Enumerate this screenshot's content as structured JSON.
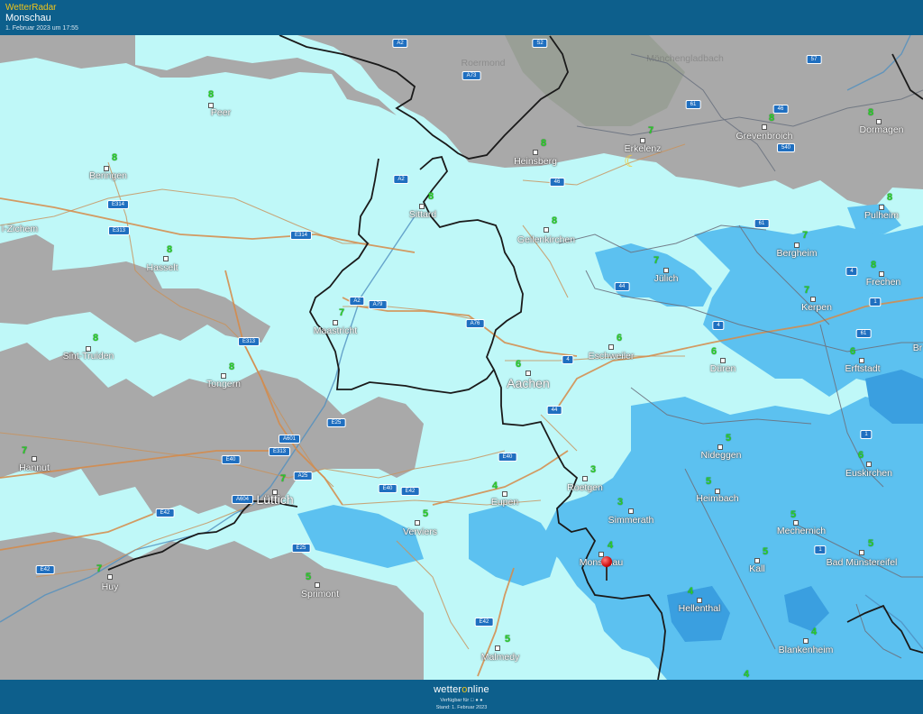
{
  "header": {
    "brand": "WetterRadar",
    "location": "Monschau",
    "timestamp": "1. Februar 2023 um 17:55"
  },
  "footer": {
    "logo_pre": "wetter",
    "logo_o": "o",
    "logo_post": "nline",
    "availability": "Verfügbar für  ● ●",
    "stand": "Stand: 1. Februar 2023"
  },
  "cities": [
    {
      "id": "peer",
      "name": "Peer",
      "temp": "8"
    },
    {
      "id": "beringen",
      "name": "Beringen",
      "temp": "8"
    },
    {
      "id": "hasselt",
      "name": "Hasselt",
      "temp": "8"
    },
    {
      "id": "zichem",
      "name": "l-Zichem",
      "temp": ""
    },
    {
      "id": "sint-truiden",
      "name": "Sint-Truiden",
      "temp": "8"
    },
    {
      "id": "tongern",
      "name": "Tongern",
      "temp": "8"
    },
    {
      "id": "maastricht",
      "name": "Maastricht",
      "temp": "7"
    },
    {
      "id": "hannut",
      "name": "Hannut",
      "temp": "7"
    },
    {
      "id": "luettich",
      "name": "Lüttich",
      "temp": "7"
    },
    {
      "id": "huy",
      "name": "Huy",
      "temp": "7"
    },
    {
      "id": "sprimont",
      "name": "Sprimont",
      "temp": "5"
    },
    {
      "id": "verviers",
      "name": "Verviers",
      "temp": "5"
    },
    {
      "id": "eupen",
      "name": "Eupen",
      "temp": "4"
    },
    {
      "id": "malmedy",
      "name": "Malmedy",
      "temp": "5"
    },
    {
      "id": "sittard",
      "name": "Sittard",
      "temp": "8"
    },
    {
      "id": "heinsberg",
      "name": "Heinsberg",
      "temp": "8"
    },
    {
      "id": "erkelenz",
      "name": "Erkelenz",
      "temp": "7"
    },
    {
      "id": "geilenkirchen",
      "name": "Geilenkirchen",
      "temp": "8"
    },
    {
      "id": "aachen",
      "name": "Aachen",
      "temp": "6"
    },
    {
      "id": "eschweiler",
      "name": "Eschweiler",
      "temp": "6"
    },
    {
      "id": "juelich",
      "name": "Jülich",
      "temp": "7"
    },
    {
      "id": "dueren",
      "name": "Düren",
      "temp": "6"
    },
    {
      "id": "roetgen",
      "name": "Roetgen",
      "temp": "3"
    },
    {
      "id": "simmerath",
      "name": "Simmerath",
      "temp": "3"
    },
    {
      "id": "monschau",
      "name": "Monschau",
      "temp": "4"
    },
    {
      "id": "nideggen",
      "name": "Nideggen",
      "temp": "5"
    },
    {
      "id": "heimbach",
      "name": "Heimbach",
      "temp": "5"
    },
    {
      "id": "hellenthal",
      "name": "Hellenthal",
      "temp": "4"
    },
    {
      "id": "kall",
      "name": "Kall",
      "temp": "5"
    },
    {
      "id": "mechernich",
      "name": "Mechernich",
      "temp": "5"
    },
    {
      "id": "blankenheim",
      "name": "Blankenheim",
      "temp": "4"
    },
    {
      "id": "grevenbroich",
      "name": "Grevenbroich",
      "temp": "8"
    },
    {
      "id": "dormagen",
      "name": "Dormagen",
      "temp": "8"
    },
    {
      "id": "pulheim",
      "name": "Pulheim",
      "temp": "8"
    },
    {
      "id": "bergheim",
      "name": "Bergheim",
      "temp": "7"
    },
    {
      "id": "frechen",
      "name": "Frechen",
      "temp": "8"
    },
    {
      "id": "kerpen",
      "name": "Kerpen",
      "temp": "7"
    },
    {
      "id": "erftstadt",
      "name": "Erftstadt",
      "temp": "6"
    },
    {
      "id": "euskirchen",
      "name": "Euskirchen",
      "temp": "6"
    },
    {
      "id": "bad-muenstereifel",
      "name": "Bad Münstereifel",
      "temp": "5"
    },
    {
      "id": "br",
      "name": "Br",
      "temp": ""
    },
    {
      "id": "moenchengladbach",
      "name": "Mönchengladbach",
      "temp": ""
    },
    {
      "id": "roermond",
      "name": "Roermond",
      "temp": ""
    }
  ],
  "extra_temps": [
    "4"
  ],
  "roads": [
    "A2",
    "S2",
    "57",
    "A73",
    "61",
    "46",
    "540",
    "46",
    "A2",
    "E314",
    "E313",
    "E314",
    "61",
    "4",
    "1",
    "44",
    "4",
    "A2",
    "A79",
    "A76",
    "E313",
    "61",
    "4",
    "44",
    "1",
    "E25",
    "A601",
    "E313",
    "E40",
    "A25",
    "A604",
    "E42",
    "E40",
    "E42",
    "E40",
    "1",
    "E25",
    "E42",
    "E42"
  ]
}
